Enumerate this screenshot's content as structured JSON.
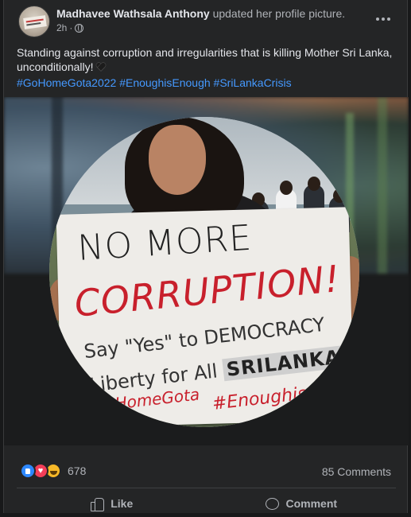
{
  "post": {
    "author": "Madhavee Wathsala Anthony",
    "action": "updated her profile picture.",
    "time": "2h",
    "separator": "·",
    "privacy_icon": "globe-icon",
    "more_icon": "more-options-icon",
    "text": "Standing against corruption and irregularities that is killing Mother Sri Lanka, unconditionally!",
    "text_emoji": "black-heart-icon",
    "hashtags": [
      "#GoHomeGota2022",
      "#EnoughisEnough",
      "#SriLankaCrisis"
    ]
  },
  "photo": {
    "placard_lines": [
      "NO MORE",
      "CORRUPTION!",
      "Say \"Yes\" to DEMOCRACY",
      "Liberty for All",
      "SRILANKANS",
      "GoHomeGota",
      "#Enoughis"
    ]
  },
  "reactions": {
    "icons": [
      "like-reaction-icon",
      "love-reaction-icon",
      "haha-reaction-icon"
    ],
    "count": "678",
    "comments": "85 Comments"
  },
  "actions": {
    "like_label": "Like",
    "comment_label": "Comment"
  },
  "colors": {
    "background": "#242526",
    "text": "#e4e6eb",
    "secondary_text": "#b0b3b8",
    "link": "#4599ff",
    "like_blue": "#2d88ff",
    "love_red": "#f33e58",
    "haha_yellow": "#f7b928",
    "placard_red": "#c8202c"
  }
}
